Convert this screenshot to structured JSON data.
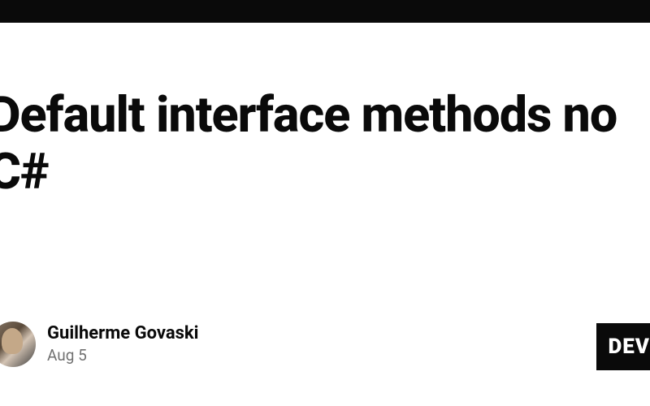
{
  "header": {
    "topbar_present": true
  },
  "article": {
    "title": "Default interface methods no C#"
  },
  "author": {
    "name": "Guilherme Govaski",
    "publish_date": "Aug 5"
  },
  "badge": {
    "text": "DEV"
  }
}
